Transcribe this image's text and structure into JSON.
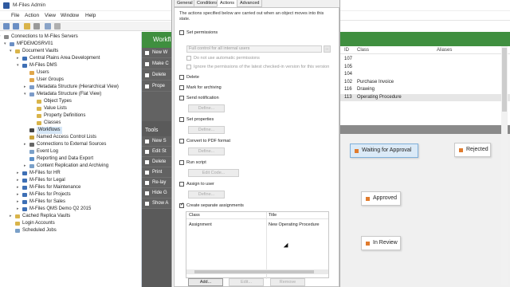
{
  "window": {
    "title": "M-Files Admin"
  },
  "menu": [
    "File",
    "Action",
    "View",
    "Window",
    "Help"
  ],
  "tree": [
    {
      "label": "Connections to M-Files Servers",
      "icon": "server-group-icon"
    },
    {
      "label": "MFDEMOSRV01",
      "icon": "server-icon"
    },
    {
      "label": "Document Vaults",
      "icon": "vault-group-icon"
    },
    {
      "label": "Central Plains Area Development",
      "icon": "vault-icon"
    },
    {
      "label": "M-Files DMS",
      "icon": "vault-icon"
    },
    {
      "label": "Users",
      "icon": "user-icon"
    },
    {
      "label": "User Groups",
      "icon": "users-icon"
    },
    {
      "label": "Metadata Structure (Hierarchical View)",
      "icon": "metadata-icon"
    },
    {
      "label": "Metadata Structure (Flat View)",
      "icon": "metadata-icon"
    },
    {
      "label": "Object Types",
      "icon": "folder-icon"
    },
    {
      "label": "Value Lists",
      "icon": "folder-icon"
    },
    {
      "label": "Property Definitions",
      "icon": "folder-icon"
    },
    {
      "label": "Classes",
      "icon": "folder-icon"
    },
    {
      "label": "Workflows",
      "icon": "workflow-icon"
    },
    {
      "label": "Named Access Control Lists",
      "icon": "acl-icon"
    },
    {
      "label": "Connections to External Sources",
      "icon": "plug-icon"
    },
    {
      "label": "Event Log",
      "icon": "log-icon"
    },
    {
      "label": "Reporting and Data Export",
      "icon": "report-icon"
    },
    {
      "label": "Content Replication and Archiving",
      "icon": "archive-icon"
    },
    {
      "label": "M-Files for HR",
      "icon": "vault-icon"
    },
    {
      "label": "M-Files for Legal",
      "icon": "vault-icon"
    },
    {
      "label": "M-Files for Maintenance",
      "icon": "vault-icon"
    },
    {
      "label": "M-Files for Projects",
      "icon": "vault-icon"
    },
    {
      "label": "M-Files for Sales",
      "icon": "vault-icon"
    },
    {
      "label": "M-Files QMS Demo Q2 2015",
      "icon": "vault-icon"
    },
    {
      "label": "Cached Replica Vaults",
      "icon": "vault-group-icon"
    },
    {
      "label": "Login Accounts",
      "icon": "key-icon"
    },
    {
      "label": "Scheduled Jobs",
      "icon": "clock-icon"
    }
  ],
  "workflow_header": "Workfl",
  "workflow_actions": [
    "New W",
    "Make C",
    "Delete",
    "Prope"
  ],
  "tools_header": "Tools",
  "tools_actions": [
    "New S",
    "Edit St",
    "Delete",
    "Print",
    "Re-lay",
    "Hide G",
    "Show A"
  ],
  "states_table": {
    "columns": [
      "ID",
      "Class",
      "Aliases"
    ],
    "rows": [
      {
        "id": "107",
        "class": ""
      },
      {
        "id": "105",
        "class": ""
      },
      {
        "id": "104",
        "class": ""
      },
      {
        "id": "102",
        "class": "Purchase Invoice"
      },
      {
        "id": "116",
        "class": "Drawing"
      },
      {
        "id": "113",
        "class": "Operating Procedure"
      }
    ]
  },
  "workflow_states": [
    "Waiting for Approval",
    "Rejected",
    "Approved",
    "In Review"
  ],
  "dialog": {
    "tabs": [
      "General",
      "Conditions",
      "Actions",
      "Advanced"
    ],
    "description": "The actions specified below are carried out when an object moves into this state.",
    "set_permissions": "Set permissions",
    "permission_value": "Full control for all internal users",
    "combo_button": "...",
    "no_auto_permissions": "Do not use automatic permissions",
    "ignore_permissions": "Ignore the permissions of the latest checked-in version for this version",
    "delete": "Delete",
    "mark_archiving": "Mark for archiving",
    "send_notification": "Send notification",
    "define": "Define...",
    "set_properties": "Set properties",
    "convert_pdf": "Convert to PDF format",
    "run_script": "Run script",
    "edit_code": "Edit Code...",
    "assign_user": "Assign to user",
    "create_assignments": "Create separate assignments",
    "assign_columns": [
      "Class",
      "Title"
    ],
    "assign_rows": [
      {
        "class": "Assignment",
        "title": "New Operating Procedure"
      }
    ],
    "add_btn": "Add...",
    "edit_btn": "Edit...",
    "remove_btn": "Remove"
  },
  "colors": {
    "workflow_green": "#3f8f3f",
    "state_orange": "#e07b2e",
    "selected_state": "#dbeaf7"
  }
}
